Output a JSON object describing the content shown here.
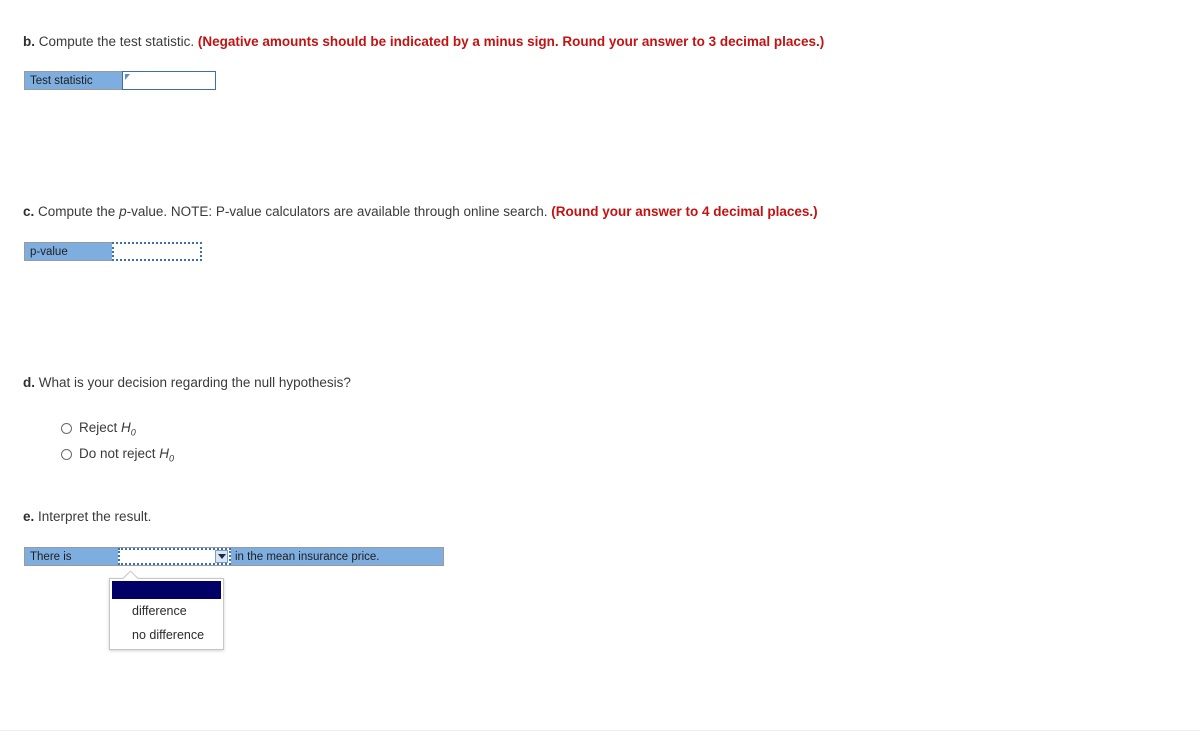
{
  "questions": {
    "b": {
      "letter": "b.",
      "text": " Compute the test statistic. ",
      "emphasis": "(Negative amounts should be indicated by a minus sign. Round your answer to 3 decimal places.)",
      "field": {
        "label": "Test statistic",
        "value": "",
        "placeholder": ""
      }
    },
    "c": {
      "letter": "c.",
      "text_part1": " Compute the ",
      "text_italic": "p",
      "text_part2": "-value. NOTE: P-value calculators are available through online search. ",
      "emphasis": "(Round your answer to 4 decimal places.)",
      "field": {
        "label_italic": "p",
        "label_rest": "-value",
        "value": "",
        "placeholder": ""
      }
    },
    "d": {
      "letter": "d.",
      "text": " What is your decision regarding the null hypothesis?",
      "options": [
        {
          "id": "reject",
          "prefix": "Reject ",
          "symbol": "H",
          "subscript": "0",
          "selected": false
        },
        {
          "id": "do-not-reject",
          "prefix": "Do not reject ",
          "symbol": "H",
          "subscript": "0",
          "selected": false
        }
      ]
    },
    "e": {
      "letter": "e.",
      "text": " Interpret the result.",
      "statement": {
        "lead": "There is",
        "tail": "in the mean insurance price.",
        "selected_value": ""
      },
      "dropdown": {
        "open": true,
        "options": [
          {
            "label": "",
            "highlighted": true
          },
          {
            "label": "difference",
            "highlighted": false
          },
          {
            "label": "no difference",
            "highlighted": false
          }
        ]
      }
    }
  },
  "colors": {
    "label_blue": "#7eaee0",
    "emphasis_red": "#c41212",
    "body_text": "#3a3a3a",
    "dropdown_highlight": "#000066",
    "input_border_blue": "#3b6fb5"
  }
}
